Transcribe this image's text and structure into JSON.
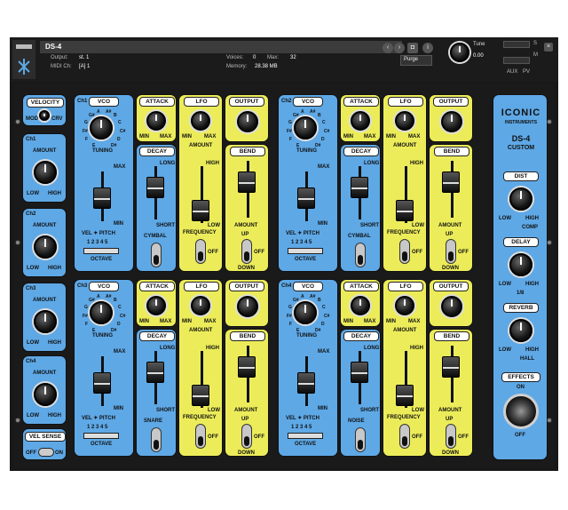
{
  "header": {
    "instrument_name": "DS-4",
    "output_label": "Output:",
    "output_value": "st. 1",
    "midi_label": "MIDI Ch:",
    "midi_value": "[A] 1",
    "voices_label": "Voices:",
    "voices_value": "0",
    "max_label": "Max:",
    "max_value": "32",
    "memory_label": "Memory:",
    "memory_value": "28.38 MB",
    "purge_label": "Purge",
    "tune_label": "Tune",
    "tune_value": "0.00",
    "s_label": "S",
    "m_label": "M",
    "aux_label": "AUX",
    "pv_label": "PV"
  },
  "left_column": {
    "velocity_tag": "VELOCITY",
    "velocity_mode_label": "MOD",
    "velocity_crv_label": "CRV",
    "channels": [
      {
        "label": "Ch1",
        "amount": "AMOUNT",
        "low": "LOW",
        "high": "HIGH"
      },
      {
        "label": "Ch2",
        "amount": "AMOUNT",
        "low": "LOW",
        "high": "HIGH"
      },
      {
        "label": "Ch3",
        "amount": "AMOUNT",
        "low": "LOW",
        "high": "HIGH"
      },
      {
        "label": "Ch4",
        "amount": "AMOUNT",
        "low": "LOW",
        "high": "HIGH"
      }
    ],
    "vel_sense_tag": "VEL SENSE",
    "vel_sense_off": "OFF",
    "vel_sense_on": "ON"
  },
  "vco_scale": [
    "E",
    "F",
    "F#",
    "G",
    "G#",
    "A",
    "A#",
    "B",
    "C",
    "C#",
    "D",
    "D#"
  ],
  "voices": [
    {
      "channel": "Ch1",
      "vco_tag": "VCO",
      "tuning": "TUNING",
      "max": "MAX",
      "min": "MIN",
      "vel_pitch": "VEL ✦ PITCH",
      "octave_values": "1 2 3 4 5",
      "octave": "OCTAVE",
      "attack_tag": "ATTACK",
      "attack_min": "MIN",
      "attack_max": "MAX",
      "decay_tag": "DECAY",
      "decay_long": "LONG",
      "decay_short": "SHORT",
      "noise_label": "CYMBAL",
      "lfo_tag": "LFO",
      "lfo_min": "MIN",
      "lfo_max": "MAX",
      "lfo_amount": "AMOUNT",
      "lfo_high": "HIGH",
      "lfo_low": "LOW",
      "lfo_frequency": "FREQUENCY",
      "lfo_off": "OFF",
      "output_tag": "OUTPUT",
      "bend_tag": "BEND",
      "bend_amount": "AMOUNT",
      "bend_up": "UP",
      "bend_off": "OFF",
      "bend_down": "DOWN"
    },
    {
      "channel": "Ch2",
      "vco_tag": "VCO",
      "tuning": "TUNING",
      "max": "MAX",
      "min": "MIN",
      "vel_pitch": "VEL ✦ PITCH",
      "octave_values": "1 2 3 4 5",
      "octave": "OCTAVE",
      "attack_tag": "ATTACK",
      "attack_min": "MIN",
      "attack_max": "MAX",
      "decay_tag": "DECAY",
      "decay_long": "LONG",
      "decay_short": "SHORT",
      "noise_label": "CYMBAL",
      "lfo_tag": "LFO",
      "lfo_min": "MIN",
      "lfo_max": "MAX",
      "lfo_amount": "AMOUNT",
      "lfo_high": "HIGH",
      "lfo_low": "LOW",
      "lfo_frequency": "FREQUENCY",
      "lfo_off": "OFF",
      "output_tag": "OUTPUT",
      "bend_tag": "BEND",
      "bend_amount": "AMOUNT",
      "bend_up": "UP",
      "bend_off": "OFF",
      "bend_down": "DOWN"
    },
    {
      "channel": "Ch3",
      "vco_tag": "VCO",
      "tuning": "TUNING",
      "max": "MAX",
      "min": "MIN",
      "vel_pitch": "VEL ✦ PITCH",
      "octave_values": "1 2 3 4 5",
      "octave": "OCTAVE",
      "attack_tag": "ATTACK",
      "attack_min": "MIN",
      "attack_max": "MAX",
      "decay_tag": "DECAY",
      "decay_long": "LONG",
      "decay_short": "SHORT",
      "noise_label": "SNARE",
      "lfo_tag": "LFO",
      "lfo_min": "MIN",
      "lfo_max": "MAX",
      "lfo_amount": "AMOUNT",
      "lfo_high": "HIGH",
      "lfo_low": "LOW",
      "lfo_frequency": "FREQUENCY",
      "lfo_off": "OFF",
      "output_tag": "OUTPUT",
      "bend_tag": "BEND",
      "bend_amount": "AMOUNT",
      "bend_up": "UP",
      "bend_off": "OFF",
      "bend_down": "DOWN"
    },
    {
      "channel": "Ch4",
      "vco_tag": "VCO",
      "tuning": "TUNING",
      "max": "MAX",
      "min": "MIN",
      "vel_pitch": "VEL ✦ PITCH",
      "octave_values": "1 2 3 4 5",
      "octave": "OCTAVE",
      "attack_tag": "ATTACK",
      "attack_min": "MIN",
      "attack_max": "MAX",
      "decay_tag": "DECAY",
      "decay_long": "LONG",
      "decay_short": "SHORT",
      "noise_label": "NOISE",
      "lfo_tag": "LFO",
      "lfo_min": "MIN",
      "lfo_max": "MAX",
      "lfo_amount": "AMOUNT",
      "lfo_high": "HIGH",
      "lfo_low": "LOW",
      "lfo_frequency": "FREQUENCY",
      "lfo_off": "OFF",
      "output_tag": "OUTPUT",
      "bend_tag": "BEND",
      "bend_amount": "AMOUNT",
      "bend_up": "UP",
      "bend_off": "OFF",
      "bend_down": "DOWN"
    }
  ],
  "right_column": {
    "brand": "ICONIC",
    "brand_sub": "INSTRUMENTS",
    "product": "DS-4",
    "product_sub": "CUSTOM",
    "dist_tag": "DIST",
    "dist_low": "LOW",
    "dist_high": "HIGH",
    "dist_comp": "COMP",
    "delay_tag": "DELAY",
    "delay_low": "LOW",
    "delay_high": "HIGH",
    "delay_time": "1/8",
    "reverb_tag": "REVERB",
    "reverb_low": "LOW",
    "reverb_high": "HIGH",
    "reverb_hall": "HALL",
    "effects_tag": "EFFECTS",
    "effects_on": "ON",
    "effects_off": "OFF"
  },
  "colors": {
    "blue": "#5ea8e6",
    "yellow": "#ecec5a",
    "background": "#181818"
  }
}
